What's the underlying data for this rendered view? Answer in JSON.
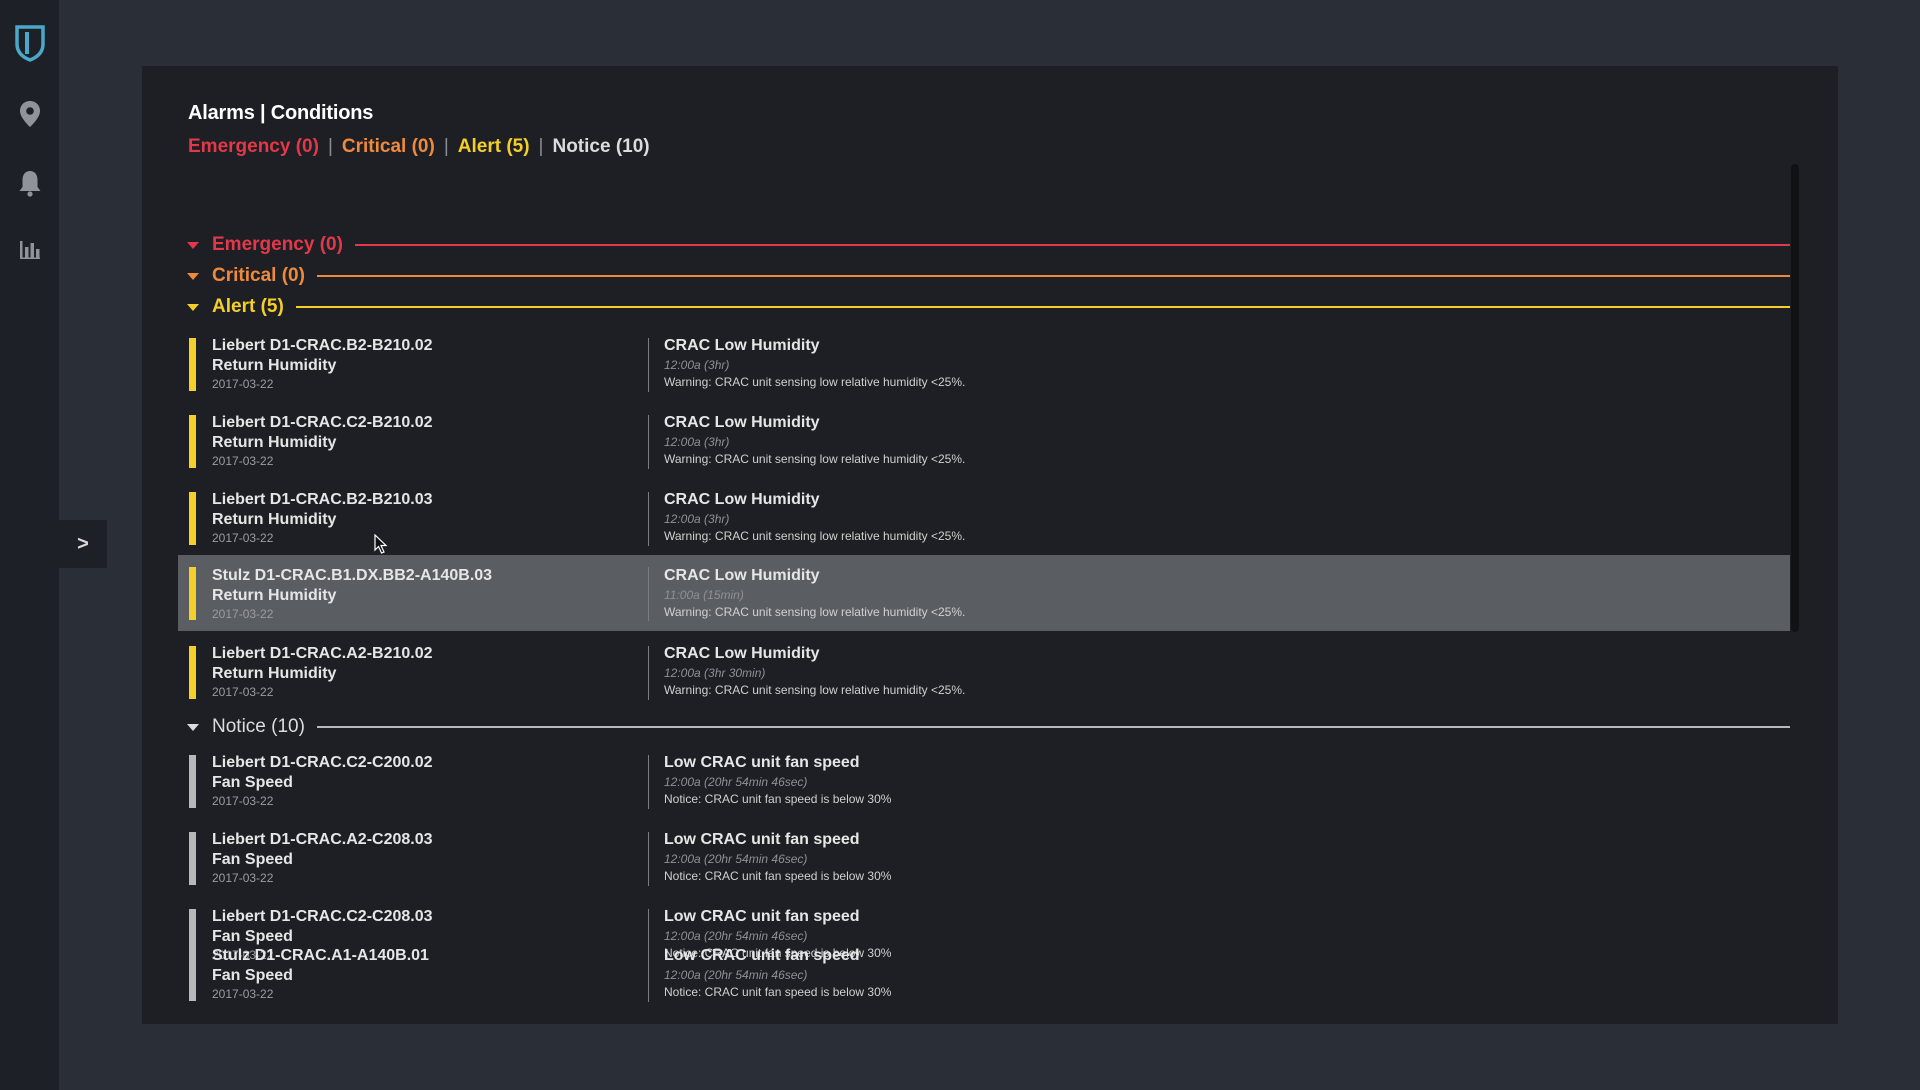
{
  "colors": {
    "emergency": "#e2384a",
    "critical": "#ef8a3c",
    "alert": "#f4cf2a",
    "notice": "#dcdcdc",
    "notice_bar": "#b8b8b8"
  },
  "sidebar": {
    "items": [
      {
        "icon": "shield-logo-icon"
      },
      {
        "icon": "map-pin-icon"
      },
      {
        "icon": "bell-icon"
      },
      {
        "icon": "bar-chart-icon"
      }
    ],
    "expand_label": ">"
  },
  "panel": {
    "title": "Alarms | Conditions",
    "summary": {
      "emergency": "Emergency (0)",
      "critical": "Critical (0)",
      "alert": "Alert (5)",
      "notice": "Notice (10)",
      "separator": "|"
    }
  },
  "groups": {
    "emergency": {
      "label": "Emergency  (0)"
    },
    "critical": {
      "label": "Critical  (0)"
    },
    "alert": {
      "label": "Alert  (5)",
      "rows": [
        {
          "device": "Liebert D1-CRAC.B2-B210.02",
          "metric": "Return Humidity",
          "date": "2017-03-22",
          "title": "CRAC Low Humidity",
          "time": "12:00a (3hr)",
          "message": "Warning: CRAC unit sensing low relative humidity <25%."
        },
        {
          "device": "Liebert D1-CRAC.C2-B210.02",
          "metric": "Return Humidity",
          "date": "2017-03-22",
          "title": "CRAC Low Humidity",
          "time": "12:00a (3hr)",
          "message": "Warning: CRAC unit sensing low relative humidity <25%."
        },
        {
          "device": "Liebert D1-CRAC.B2-B210.03",
          "metric": "Return Humidity",
          "date": "2017-03-22",
          "title": "CRAC Low Humidity",
          "time": "12:00a (3hr)",
          "message": "Warning: CRAC unit sensing low relative humidity <25%."
        },
        {
          "device": "Stulz D1-CRAC.B1.DX.BB2-A140B.03",
          "metric": "Return Humidity",
          "date": "2017-03-22",
          "title": "CRAC Low Humidity",
          "time": "11:00a (15min)",
          "message": "Warning: CRAC unit sensing low relative humidity <25%."
        },
        {
          "device": "Liebert D1-CRAC.A2-B210.02",
          "metric": "Return Humidity",
          "date": "2017-03-22",
          "title": "CRAC Low Humidity",
          "time": "12:00a (3hr 30min)",
          "message": "Warning: CRAC unit sensing low relative humidity <25%."
        }
      ]
    },
    "notice": {
      "label": "Notice  (10)",
      "rows": [
        {
          "device": "Liebert D1-CRAC.C2-C200.02",
          "metric": "Fan Speed",
          "date": "2017-03-22",
          "title": "Low CRAC unit fan speed",
          "time": "12:00a (20hr 54min 46sec)",
          "message": "Notice: CRAC unit fan speed is below 30%"
        },
        {
          "device": "Liebert D1-CRAC.A2-C208.03",
          "metric": "Fan Speed",
          "date": "2017-03-22",
          "title": "Low CRAC unit fan speed",
          "time": "12:00a (20hr 54min 46sec)",
          "message": "Notice: CRAC unit fan speed is below 30%"
        },
        {
          "device": "Liebert D1-CRAC.C2-C208.03",
          "metric": "Fan Speed",
          "date": "2017-03-22",
          "title": "Low CRAC unit fan speed",
          "time": "12:00a (20hr 54min 46sec)",
          "message": "Notice: CRAC unit fan speed is below 30%"
        },
        {
          "device": "Stulz D1-CRAC.A1-A140B.01",
          "metric": "Fan Speed",
          "date": "2017-03-22",
          "title": "Low CRAC unit fan speed",
          "time": "12:00a (20hr 54min 46sec)",
          "message": "Notice: CRAC unit fan speed is below 30%"
        }
      ]
    }
  }
}
